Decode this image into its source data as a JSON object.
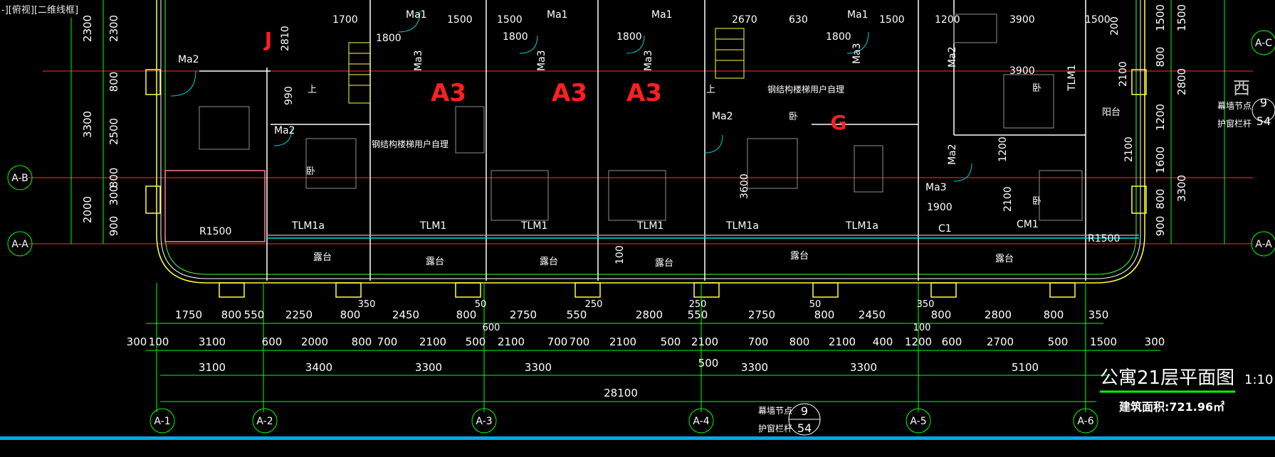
{
  "viewport": {
    "label": "-][俯视][二维线框]"
  },
  "title": {
    "text": "公寓21层平面图",
    "scale": "1:10",
    "area": "建筑面积:721.96㎡"
  },
  "compass": {
    "label": "西"
  },
  "axes_bottom": [
    "A-1",
    "A-2",
    "A-3",
    "A-4",
    "A-5",
    "A-6"
  ],
  "axes_left": [
    "A-B",
    "A-A"
  ],
  "axes_right": [
    "A-C",
    "A-A"
  ],
  "unit_labels": [
    "J",
    "A3",
    "A3",
    "A3",
    "G"
  ],
  "dims_row1": [
    "1750",
    "800",
    "550",
    "2250",
    "800",
    "2450",
    "800",
    "2750",
    "550",
    "2800",
    "550",
    "2750",
    "800",
    "2450",
    "800",
    "2800",
    "800",
    "350"
  ],
  "dims_row1_small": [
    "350",
    "50",
    "250",
    "250",
    "50",
    "350",
    "600",
    "100"
  ],
  "dims_row2": [
    "300",
    "100",
    "3100",
    "600",
    "2000",
    "800",
    "700",
    "2100",
    "500",
    "2100",
    "700",
    "700",
    "2100",
    "500",
    "2100",
    "700",
    "800",
    "2100",
    "400",
    "1200",
    "600",
    "2700",
    "500",
    "1500",
    "300"
  ],
  "dims_row3": [
    "3100",
    "3400",
    "3300",
    "3300",
    "500",
    "3300",
    "3300",
    "5100"
  ],
  "dims_total": "28100",
  "dims_left_outer": [
    "2300",
    "3300",
    "2000"
  ],
  "dims_left_inner": [
    "2300",
    "800",
    "2500",
    "800",
    "300",
    "900"
  ],
  "dims_right_a": [
    "1500",
    "800",
    "1200",
    "1600",
    "800",
    "900"
  ],
  "dims_right_b": [
    "1500",
    "2800",
    "3300"
  ],
  "room_tags": [
    "Ma2",
    "Ma2",
    "Ma1",
    "Ma1",
    "Ma1",
    "Ma1",
    "Ma3",
    "Ma3",
    "Ma3",
    "Ma3",
    "Ma2",
    "Ma2",
    "Ma2",
    "Ma3",
    "TLM1",
    "TLM1a",
    "TLM1",
    "TLM1",
    "TLM1",
    "TLM1a",
    "TLM1a",
    "C1",
    "CM1",
    "R1500",
    "R1500"
  ],
  "room_names": [
    "卧",
    "卧",
    "卧",
    "卧",
    "露台",
    "露台",
    "露台",
    "露台",
    "露台",
    "露台",
    "阳台",
    "上",
    "上"
  ],
  "interior_dims": [
    "1700",
    "2810",
    "990",
    "1500",
    "1500",
    "1800",
    "1800",
    "1800",
    "2670",
    "630",
    "1800",
    "1500",
    "1200",
    "3900",
    "1500",
    "3900",
    "2100",
    "3600",
    "1200",
    "1900",
    "2100",
    "100",
    "200",
    "2100"
  ],
  "notes": [
    "钢结构楼梯用户自理",
    "钢结构楼梯用户自理",
    "幕墙节点",
    "护窗栏杆",
    "幕墙节点",
    "护窗栏杆"
  ],
  "detail_refs": [
    {
      "top": "9",
      "bottom": "54"
    },
    {
      "top": "9",
      "bottom": "54"
    }
  ],
  "colors": {
    "background": "#000000",
    "wall": "#ffffff",
    "dim": "#00ff00",
    "axis_line": "#ff0000",
    "text": "#ffffff",
    "accent_red": "#ff2020",
    "window": "#ffff00",
    "door_swing": "#00d0d0",
    "status_bar": "#00a8e8"
  }
}
